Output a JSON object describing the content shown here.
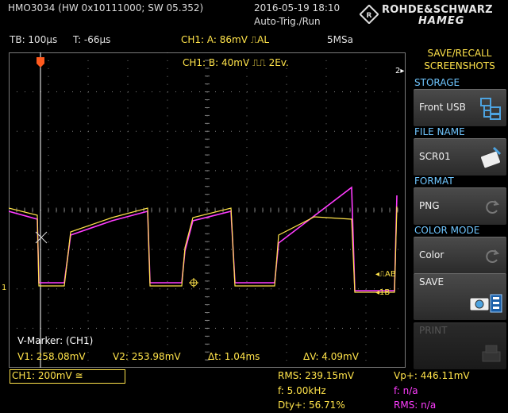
{
  "header": {
    "model": "HMO3034 (HW 0x10111000; SW 05.352)",
    "datetime": "2016-05-19 18:10",
    "trigger_mode": "Auto-Trig./Run",
    "brand_line1": "ROHDE&SCHWARZ",
    "brand_line2": "HAMEG"
  },
  "infobar": {
    "timebase": "TB: 100µs",
    "trigger_time": "T: -66µs",
    "trigger_a": "CH1: A: 86mV ⎍AL",
    "sample_rate": "5MSa",
    "trigger_b": "CH1: B: 40mV ⎍⎍ 2Ev."
  },
  "markers": {
    "right_2": "2▸",
    "left_1": "1",
    "trig_ab": "◂⎍AB",
    "trig_1b": "◂1B"
  },
  "vmarker": {
    "title": "V-Marker: (CH1)",
    "v1": "V1: 258.08mV",
    "v2": "V2: 253.98mV",
    "dt": "Δt: 1.04ms",
    "dv": "ΔV: 4.09mV"
  },
  "channel": {
    "ch1_scale": "CH1: 200mV ≅"
  },
  "measurements": {
    "rms": "RMS: 239.15mV",
    "vp": "Vp+: 446.11mV",
    "freq": "f: 5.00kHz",
    "f_na": "f: n/a",
    "duty": "Dty+: 56.71%",
    "rms_na": "RMS: n/a"
  },
  "menu": {
    "title_line1": "SAVE/RECALL",
    "title_line2": "SCREENSHOTS",
    "storage_label": "STORAGE",
    "storage_value": "Front USB",
    "filename_label": "FILE NAME",
    "filename_value": "SCR01",
    "format_label": "FORMAT",
    "format_value": "PNG",
    "colormode_label": "COLOR MODE",
    "colormode_value": "Color",
    "save_label": "SAVE",
    "print_label": "PRINT"
  },
  "colors": {
    "ch1": "#ffe34a",
    "math": "#ff3cff",
    "menu_label": "#6fc6ff",
    "grid": "#7a7a7a"
  }
}
